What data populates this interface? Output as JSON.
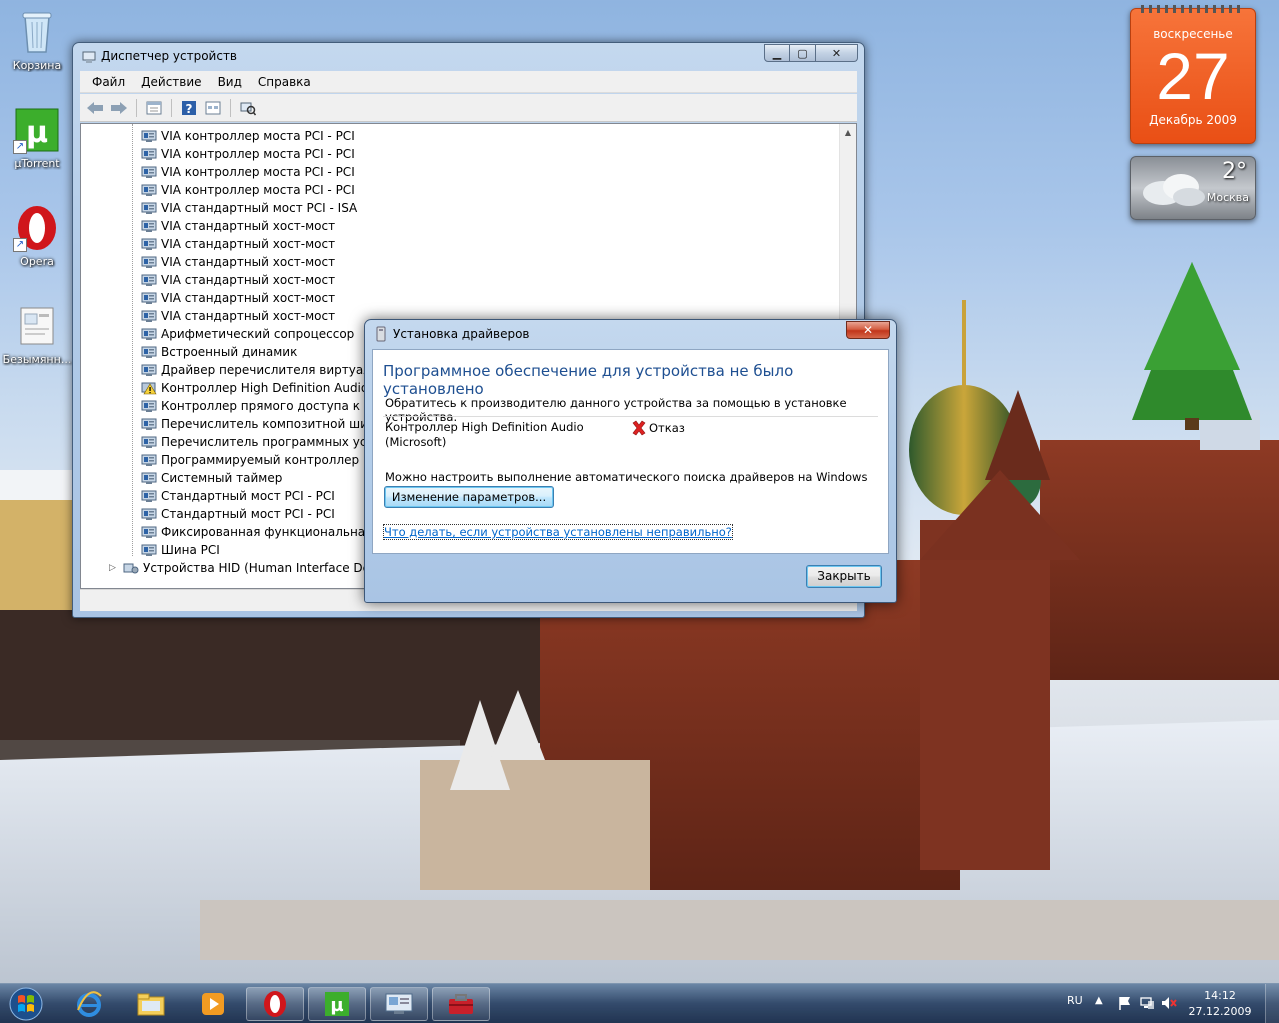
{
  "desktop": {
    "icons": [
      {
        "label": "Корзина",
        "icon": "recycle-bin-icon"
      },
      {
        "label": "µTorrent",
        "icon": "utorrent-icon"
      },
      {
        "label": "Opera",
        "icon": "opera-icon"
      },
      {
        "label": "Безымянн...",
        "icon": "file-icon"
      }
    ]
  },
  "gadgets": {
    "calendar": {
      "weekday": "воскресенье",
      "day": "27",
      "month_year": "Декабрь 2009"
    },
    "weather": {
      "temp": "2°",
      "city": "Москва"
    }
  },
  "device_manager": {
    "title": "Диспетчер устройств",
    "menu": [
      "Файл",
      "Действие",
      "Вид",
      "Справка"
    ],
    "toolbar_icons": [
      "back-arrow-icon",
      "forward-arrow-icon",
      "properties-icon",
      "help-icon",
      "view-icon",
      "scan-hardware-icon"
    ],
    "tree_items": [
      {
        "label": "VIA контроллер моста PCI - PCI",
        "warn": false
      },
      {
        "label": "VIA контроллер моста PCI - PCI",
        "warn": false
      },
      {
        "label": "VIA контроллер моста PCI - PCI",
        "warn": false
      },
      {
        "label": "VIA контроллер моста PCI - PCI",
        "warn": false
      },
      {
        "label": "VIA стандартный мост PCI - ISA",
        "warn": false
      },
      {
        "label": "VIA стандартный хост-мост",
        "warn": false
      },
      {
        "label": "VIA стандартный хост-мост",
        "warn": false
      },
      {
        "label": "VIA стандартный хост-мост",
        "warn": false
      },
      {
        "label": "VIA стандартный хост-мост",
        "warn": false
      },
      {
        "label": "VIA стандартный хост-мост",
        "warn": false
      },
      {
        "label": "VIA стандартный хост-мост",
        "warn": false
      },
      {
        "label": "Арифметический сопроцессор",
        "warn": false
      },
      {
        "label": "Встроенный динамик",
        "warn": false
      },
      {
        "label": "Драйвер перечислителя виртуальны",
        "warn": false
      },
      {
        "label": "Контроллер High Definition Audio (M",
        "warn": true
      },
      {
        "label": "Контроллер прямого доступа к памя",
        "warn": false
      },
      {
        "label": "Перечислитель композитной шины",
        "warn": false
      },
      {
        "label": "Перечислитель программных устро",
        "warn": false
      },
      {
        "label": "Программируемый контроллер пре",
        "warn": false
      },
      {
        "label": "Системный таймер",
        "warn": false
      },
      {
        "label": "Стандартный мост PCI - PCI",
        "warn": false
      },
      {
        "label": "Стандартный мост PCI - PCI",
        "warn": false
      },
      {
        "label": "Фиксированная функциональная кно",
        "warn": false
      },
      {
        "label": "Шина PCI",
        "warn": false
      }
    ],
    "category_row": {
      "label": "Устройства HID (Human Interface Devices",
      "expander": "▷"
    }
  },
  "driver_dialog": {
    "title": "Установка драйверов",
    "close_glyph": "✕",
    "heading": "Программное обеспечение для устройства не было установлено",
    "contact_text": "Обратитесь к производителю данного устройства за помощью в установке устройства.",
    "device_name_line1": "Контроллер High Definition Audio",
    "device_name_line2": "(Microsoft)",
    "status_text": "Отказ",
    "update_note": "Можно настроить выполнение автоматического поиска драйверов на Windows Update",
    "change_button": "Изменение параметров...",
    "help_link": "Что делать, если устройства установлены неправильно?",
    "close_button": "Закрыть"
  },
  "taskbar": {
    "pinned": [
      "ie-icon",
      "explorer-icon",
      "media-player-icon",
      "opera-icon",
      "utorrent-icon",
      "device-manager-icon",
      "driver-install-icon"
    ],
    "lang": "RU",
    "time": "14:12",
    "date": "27.12.2009"
  }
}
